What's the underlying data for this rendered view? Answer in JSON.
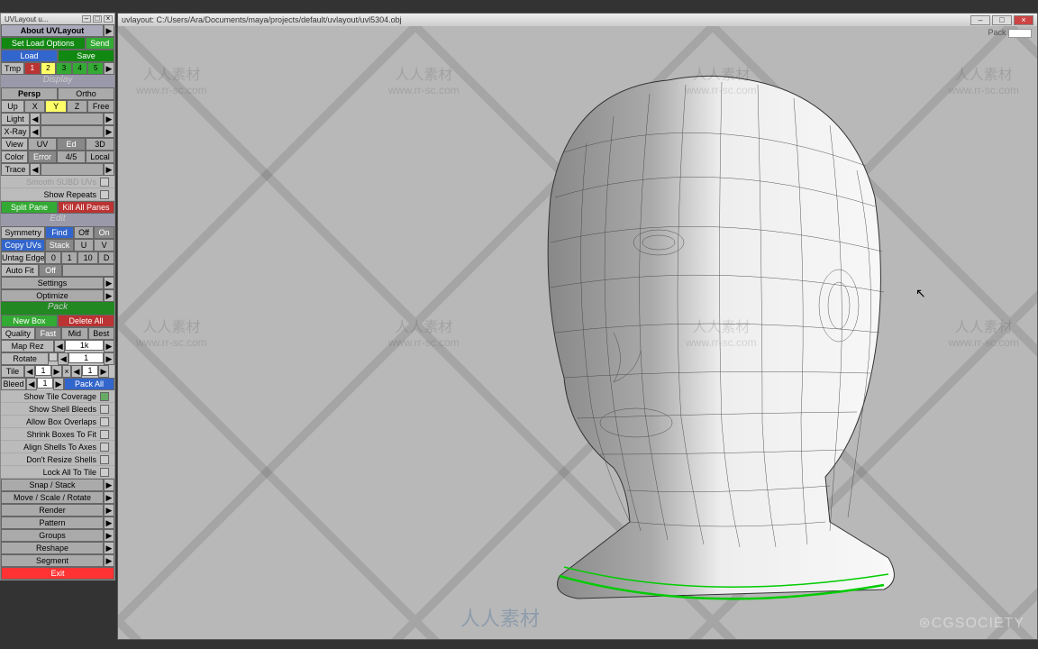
{
  "panel": {
    "titlebar": "UVLayout u...",
    "about": "About UVLayout",
    "set_load": "Set Load Options",
    "send": "Send",
    "load": "Load",
    "save": "Save",
    "tmp_label": "Tmp",
    "tmp_slots": [
      "1",
      "2",
      "3",
      "4",
      "5"
    ],
    "display_header": "Display",
    "persp": "Persp",
    "ortho": "Ortho",
    "up": "Up",
    "x": "X",
    "y": "Y",
    "z": "Z",
    "free": "Free",
    "light": "Light",
    "xray": "X-Ray",
    "view": "View",
    "uv": "UV",
    "ed": "Ed",
    "td": "3D",
    "color": "Color",
    "error": "Error",
    "fourfive": "4/5",
    "local": "Local",
    "trace": "Trace",
    "smooth": "Smooth SUBD UVs",
    "repeats": "Show Repeats",
    "split": "Split Pane",
    "kill": "Kill All Panes",
    "edit_header": "Edit",
    "symmetry": "Symmetry",
    "find": "Find",
    "off": "Off",
    "on": "On",
    "copyuv": "Copy UVs",
    "stack": "Stack",
    "u": "U",
    "v": "V",
    "untag": "Untag Edges",
    "untag_0": "0",
    "untag_1": "1",
    "untag_10": "10",
    "untag_d": "D",
    "autofit": "Auto Fit",
    "settings": "Settings",
    "optimize": "Optimize",
    "pack_header": "Pack",
    "newbox": "New Box",
    "delall": "Delete All",
    "quality": "Quality",
    "fast": "Fast",
    "mid": "Mid",
    "best": "Best",
    "maprez": "Map Rez",
    "maprez_val": "1k",
    "rotate": "Rotate",
    "rotate_val": "1",
    "tile": "Tile",
    "tile_x": "1",
    "tile_y": "1",
    "bleed": "Bleed",
    "bleed_val": "1",
    "packall": "Pack All",
    "opts": [
      "Show Tile Coverage",
      "Show Shell Bleeds",
      "Allow Box Overlaps",
      "Shrink Boxes To Fit",
      "Align Shells To Axes",
      "Don't Resize Shells",
      "Lock All To Tile"
    ],
    "dropdowns": [
      "Snap / Stack",
      "Move / Scale / Rotate",
      "Render",
      "Pattern",
      "Groups",
      "Reshape",
      "Segment"
    ],
    "exit": "Exit"
  },
  "viewport": {
    "title": "uvlayout: C:/Users/Ara/Documents/maya/projects/default/uvlayout/uvl5304.obj",
    "pack_label": "Pack"
  },
  "footer": {
    "watermark_zh": "人人素材",
    "watermark_url": "www.rr-sc.com",
    "cg": "⊛CGSOCIETY"
  },
  "colors": {
    "tmp": [
      "#b33",
      "#ff6",
      "#3a3",
      "#3a3",
      "#3a3"
    ]
  }
}
